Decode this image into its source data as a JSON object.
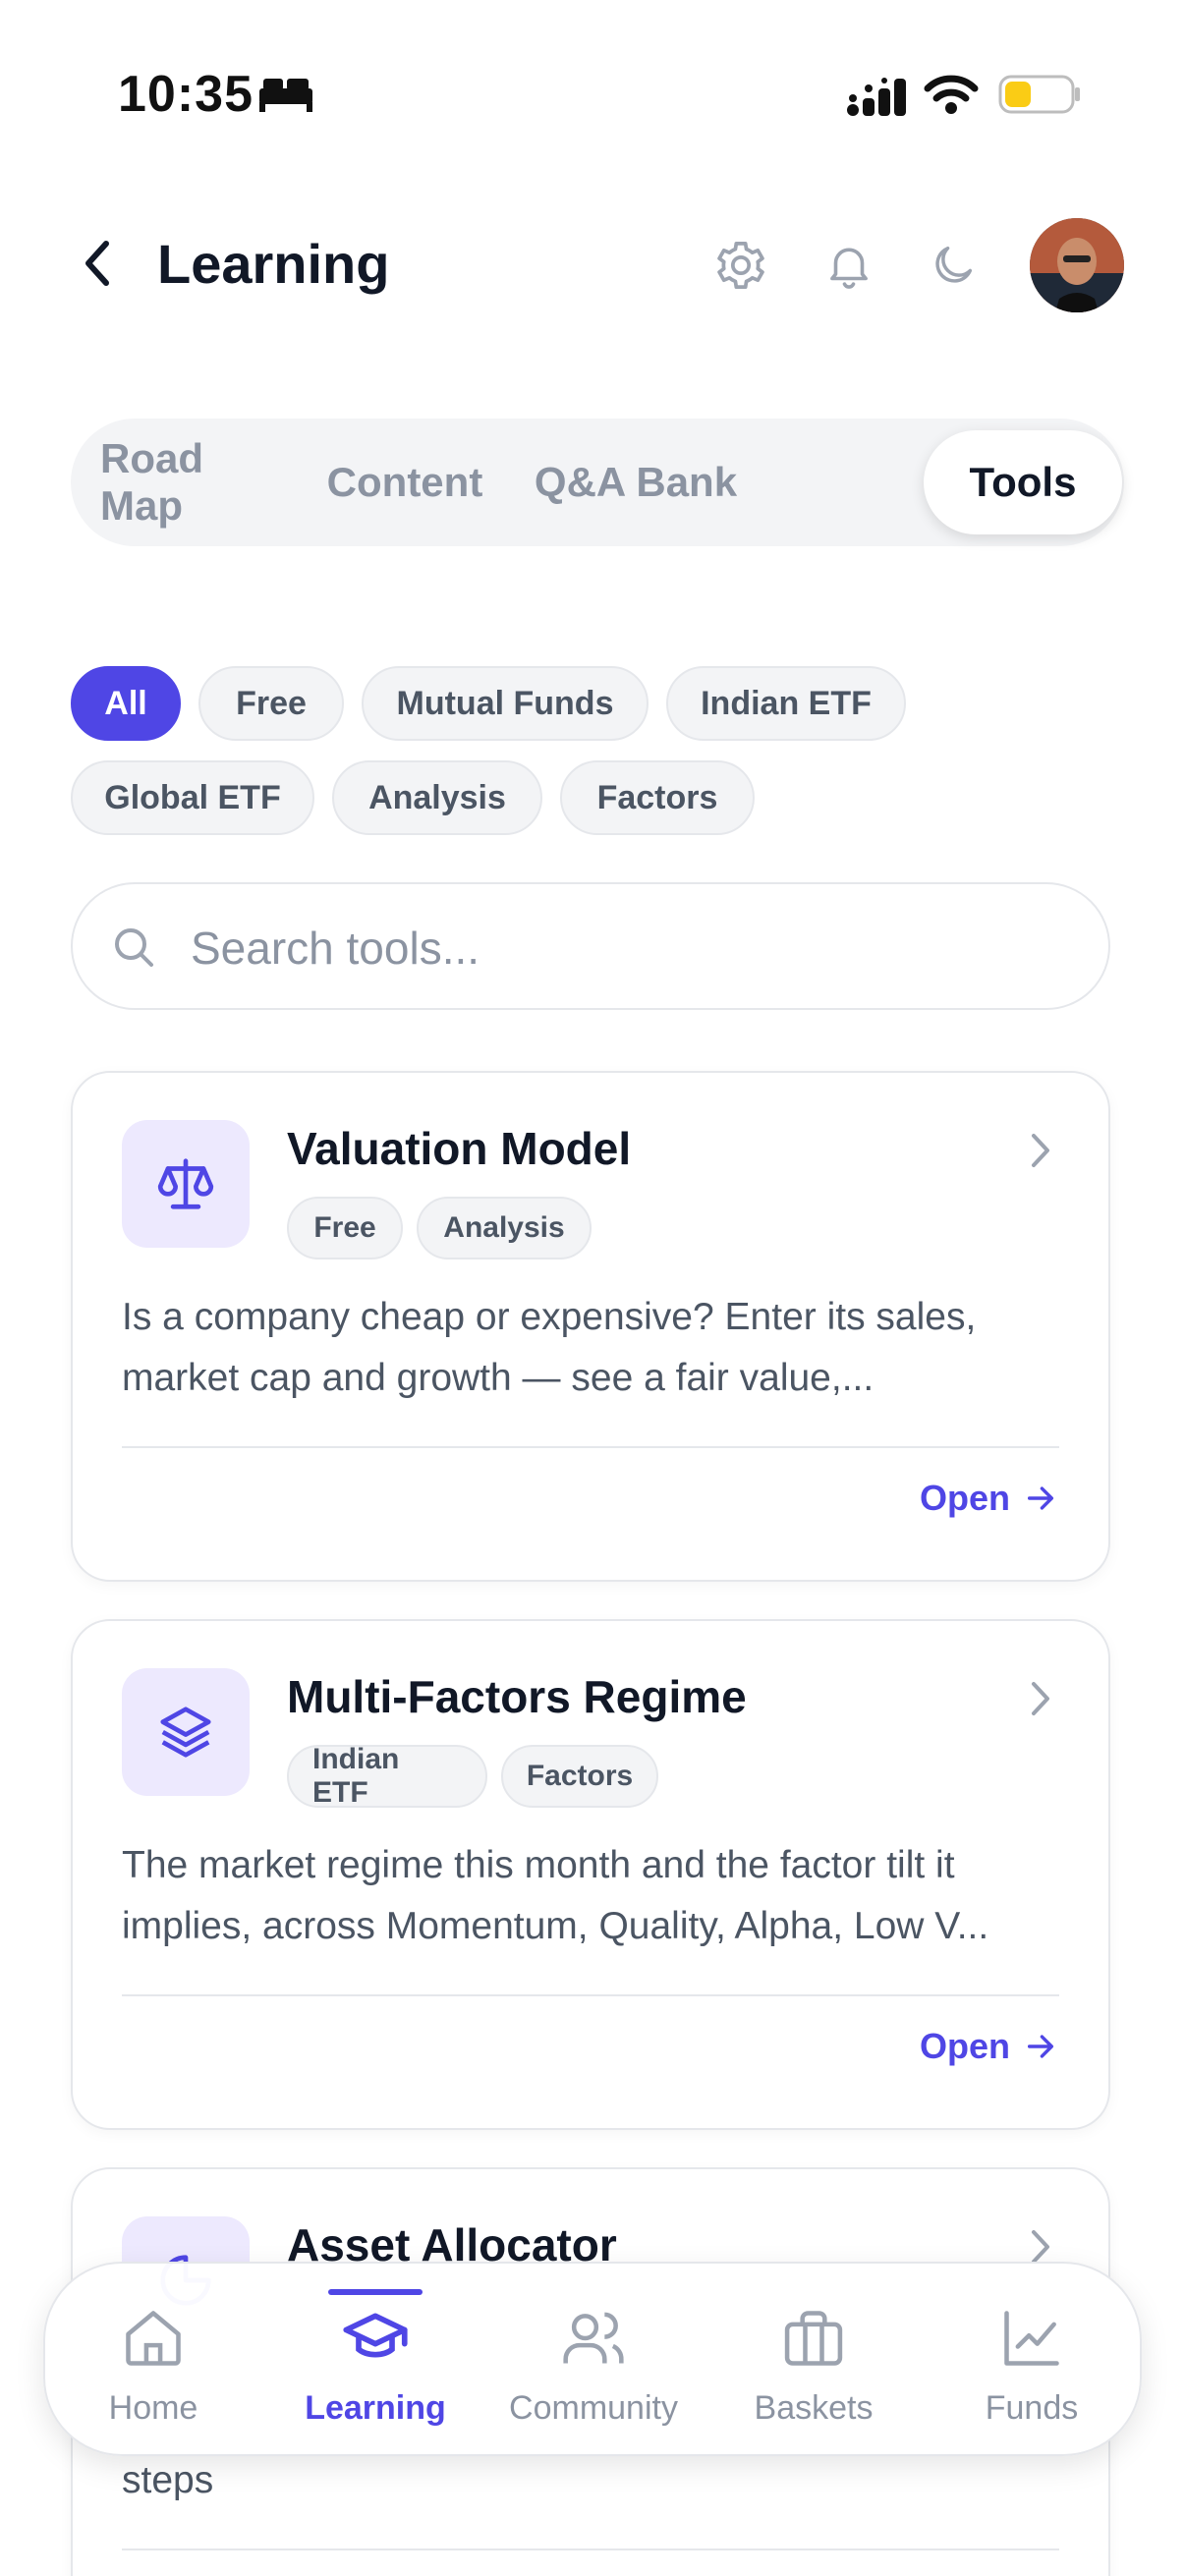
{
  "status_bar": {
    "time": "10:35"
  },
  "header": {
    "title": "Learning",
    "icons": [
      "back-icon",
      "gear-icon",
      "bell-icon",
      "moon-icon",
      "avatar"
    ]
  },
  "tabs": [
    {
      "label": "Road Map",
      "active": false
    },
    {
      "label": "Content",
      "active": false
    },
    {
      "label": "Q&A Bank",
      "active": false
    },
    {
      "label": "Tools",
      "active": true
    }
  ],
  "filters": [
    {
      "label": "All",
      "active": true
    },
    {
      "label": "Free",
      "active": false
    },
    {
      "label": "Mutual Funds",
      "active": false
    },
    {
      "label": "Indian ETF",
      "active": false
    },
    {
      "label": "Global ETF",
      "active": false
    },
    {
      "label": "Analysis",
      "active": false
    },
    {
      "label": "Factors",
      "active": false
    }
  ],
  "search": {
    "placeholder": "Search tools...",
    "value": ""
  },
  "cards": [
    {
      "icon": "scale-icon",
      "title": "Valuation Model",
      "tags": [
        "Free",
        "Analysis"
      ],
      "description": "Is a company cheap or expensive? Enter its sales, market cap and growth — see a fair value,...",
      "action": "Open"
    },
    {
      "icon": "layers-icon",
      "title": "Multi-Factors Regime",
      "tags": [
        "Indian ETF",
        "Factors"
      ],
      "description": "The market regime this month and the factor tilt it implies, across Momentum, Quality, Alpha, Low V...",
      "action": "Open"
    },
    {
      "icon": "pie-icon",
      "title": "Asset Allocator",
      "tags": [],
      "description": "steps",
      "action": ""
    }
  ],
  "bottom_nav": [
    {
      "label": "Home",
      "icon": "home-icon",
      "active": false
    },
    {
      "label": "Learning",
      "icon": "graduation-cap-icon",
      "active": true
    },
    {
      "label": "Community",
      "icon": "users-icon",
      "active": false
    },
    {
      "label": "Baskets",
      "icon": "briefcase-icon",
      "active": false
    },
    {
      "label": "Funds",
      "icon": "chart-line-icon",
      "active": false
    }
  ],
  "colors": {
    "accent": "#4f46e5",
    "icon_bg": "#ede9fe",
    "muted_text": "#8b93a1",
    "battery": "#facc15"
  }
}
